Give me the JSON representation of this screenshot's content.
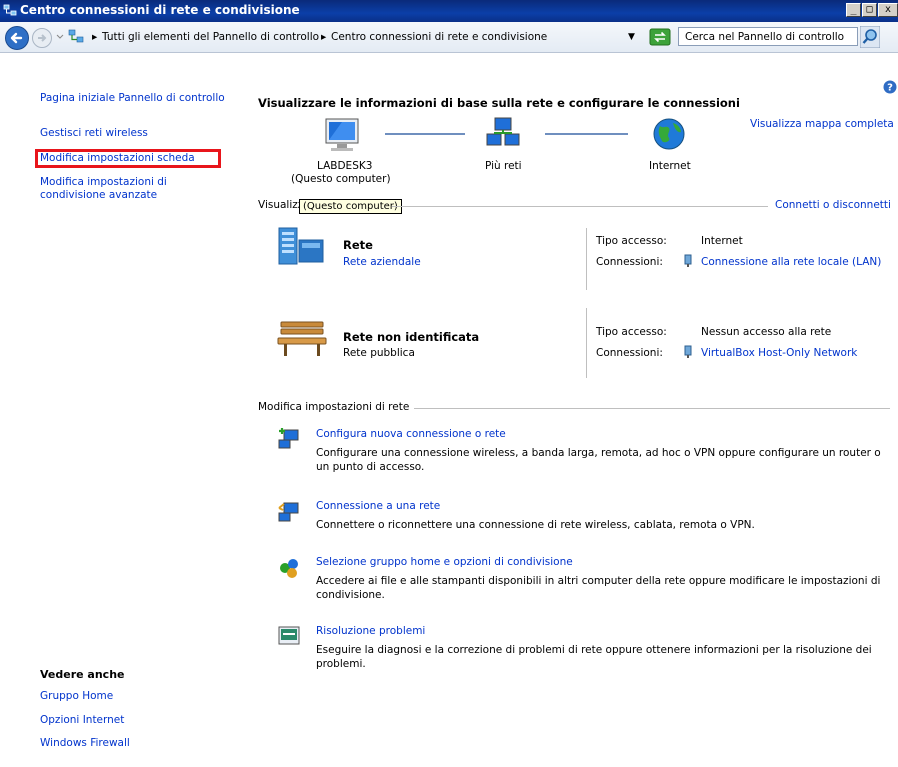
{
  "window": {
    "title": "Centro connessioni di rete e condivisione",
    "min_label": "_",
    "max_label": "□",
    "close_label": "x"
  },
  "address": {
    "crumb_root": "Tutti gli elementi del Pannello di controllo",
    "crumb_current": "Centro connessioni di rete e condivisione",
    "search_placeholder": "Cerca nel Pannello di controllo"
  },
  "sidebar": {
    "home": "Pagina iniziale Pannello di controllo",
    "items": [
      "Gestisci reti wireless",
      "Modifica impostazioni scheda",
      "Modifica impostazioni di",
      "condivisione avanzate"
    ],
    "see_also_title": "Vedere anche",
    "see_also": [
      "Gruppo Home",
      "Opzioni Internet",
      "Windows Firewall"
    ]
  },
  "main": {
    "heading": "Visualizzare le informazioni di base sulla rete e configurare le connessioni",
    "full_map_link": "Visualizza mappa completa",
    "map": {
      "computer_name": "LABDESK3",
      "computer_sub": "(Questo computer)",
      "multi_networks": "Più reti",
      "internet": "Internet"
    },
    "active_section_label": "Visualizz",
    "tooltip": "(Questo computer)",
    "connect_link": "Connetti o disconnetti",
    "networks": [
      {
        "name": "Rete",
        "type": "Rete aziendale",
        "access_label": "Tipo accesso:",
        "access_value": "Internet",
        "conn_label": "Connessioni:",
        "conn_value": "Connessione alla rete locale (LAN)"
      },
      {
        "name": "Rete non identificata",
        "type": "Rete pubblica",
        "access_label": "Tipo accesso:",
        "access_value": "Nessun accesso alla rete",
        "conn_label": "Connessioni:",
        "conn_value": "VirtualBox Host-Only Network"
      }
    ],
    "settings_section_label": "Modifica impostazioni di rete",
    "tasks": [
      {
        "title": "Configura nuova connessione o rete",
        "desc1": "Configurare una connessione wireless, a banda larga, remota, ad hoc o VPN oppure configurare un router o",
        "desc2": "un punto di accesso."
      },
      {
        "title": "Connessione a una rete",
        "desc1": "Connettere o riconnettere una connessione di rete wireless, cablata, remota o VPN.",
        "desc2": ""
      },
      {
        "title": "Selezione gruppo home e opzioni di condivisione",
        "desc1": "Accedere ai file e alle stampanti disponibili in altri computer della rete oppure modificare le impostazioni di",
        "desc2": "condivisione."
      },
      {
        "title": "Risoluzione problemi",
        "desc1": "Eseguire la diagnosi e la correzione di problemi di rete oppure ottenere informazioni per la risoluzione dei",
        "desc2": "problemi."
      }
    ]
  },
  "colors": {
    "link": "#0033cc",
    "highlight_box": "#e8151b",
    "title_bar": "#0b3fa8"
  }
}
